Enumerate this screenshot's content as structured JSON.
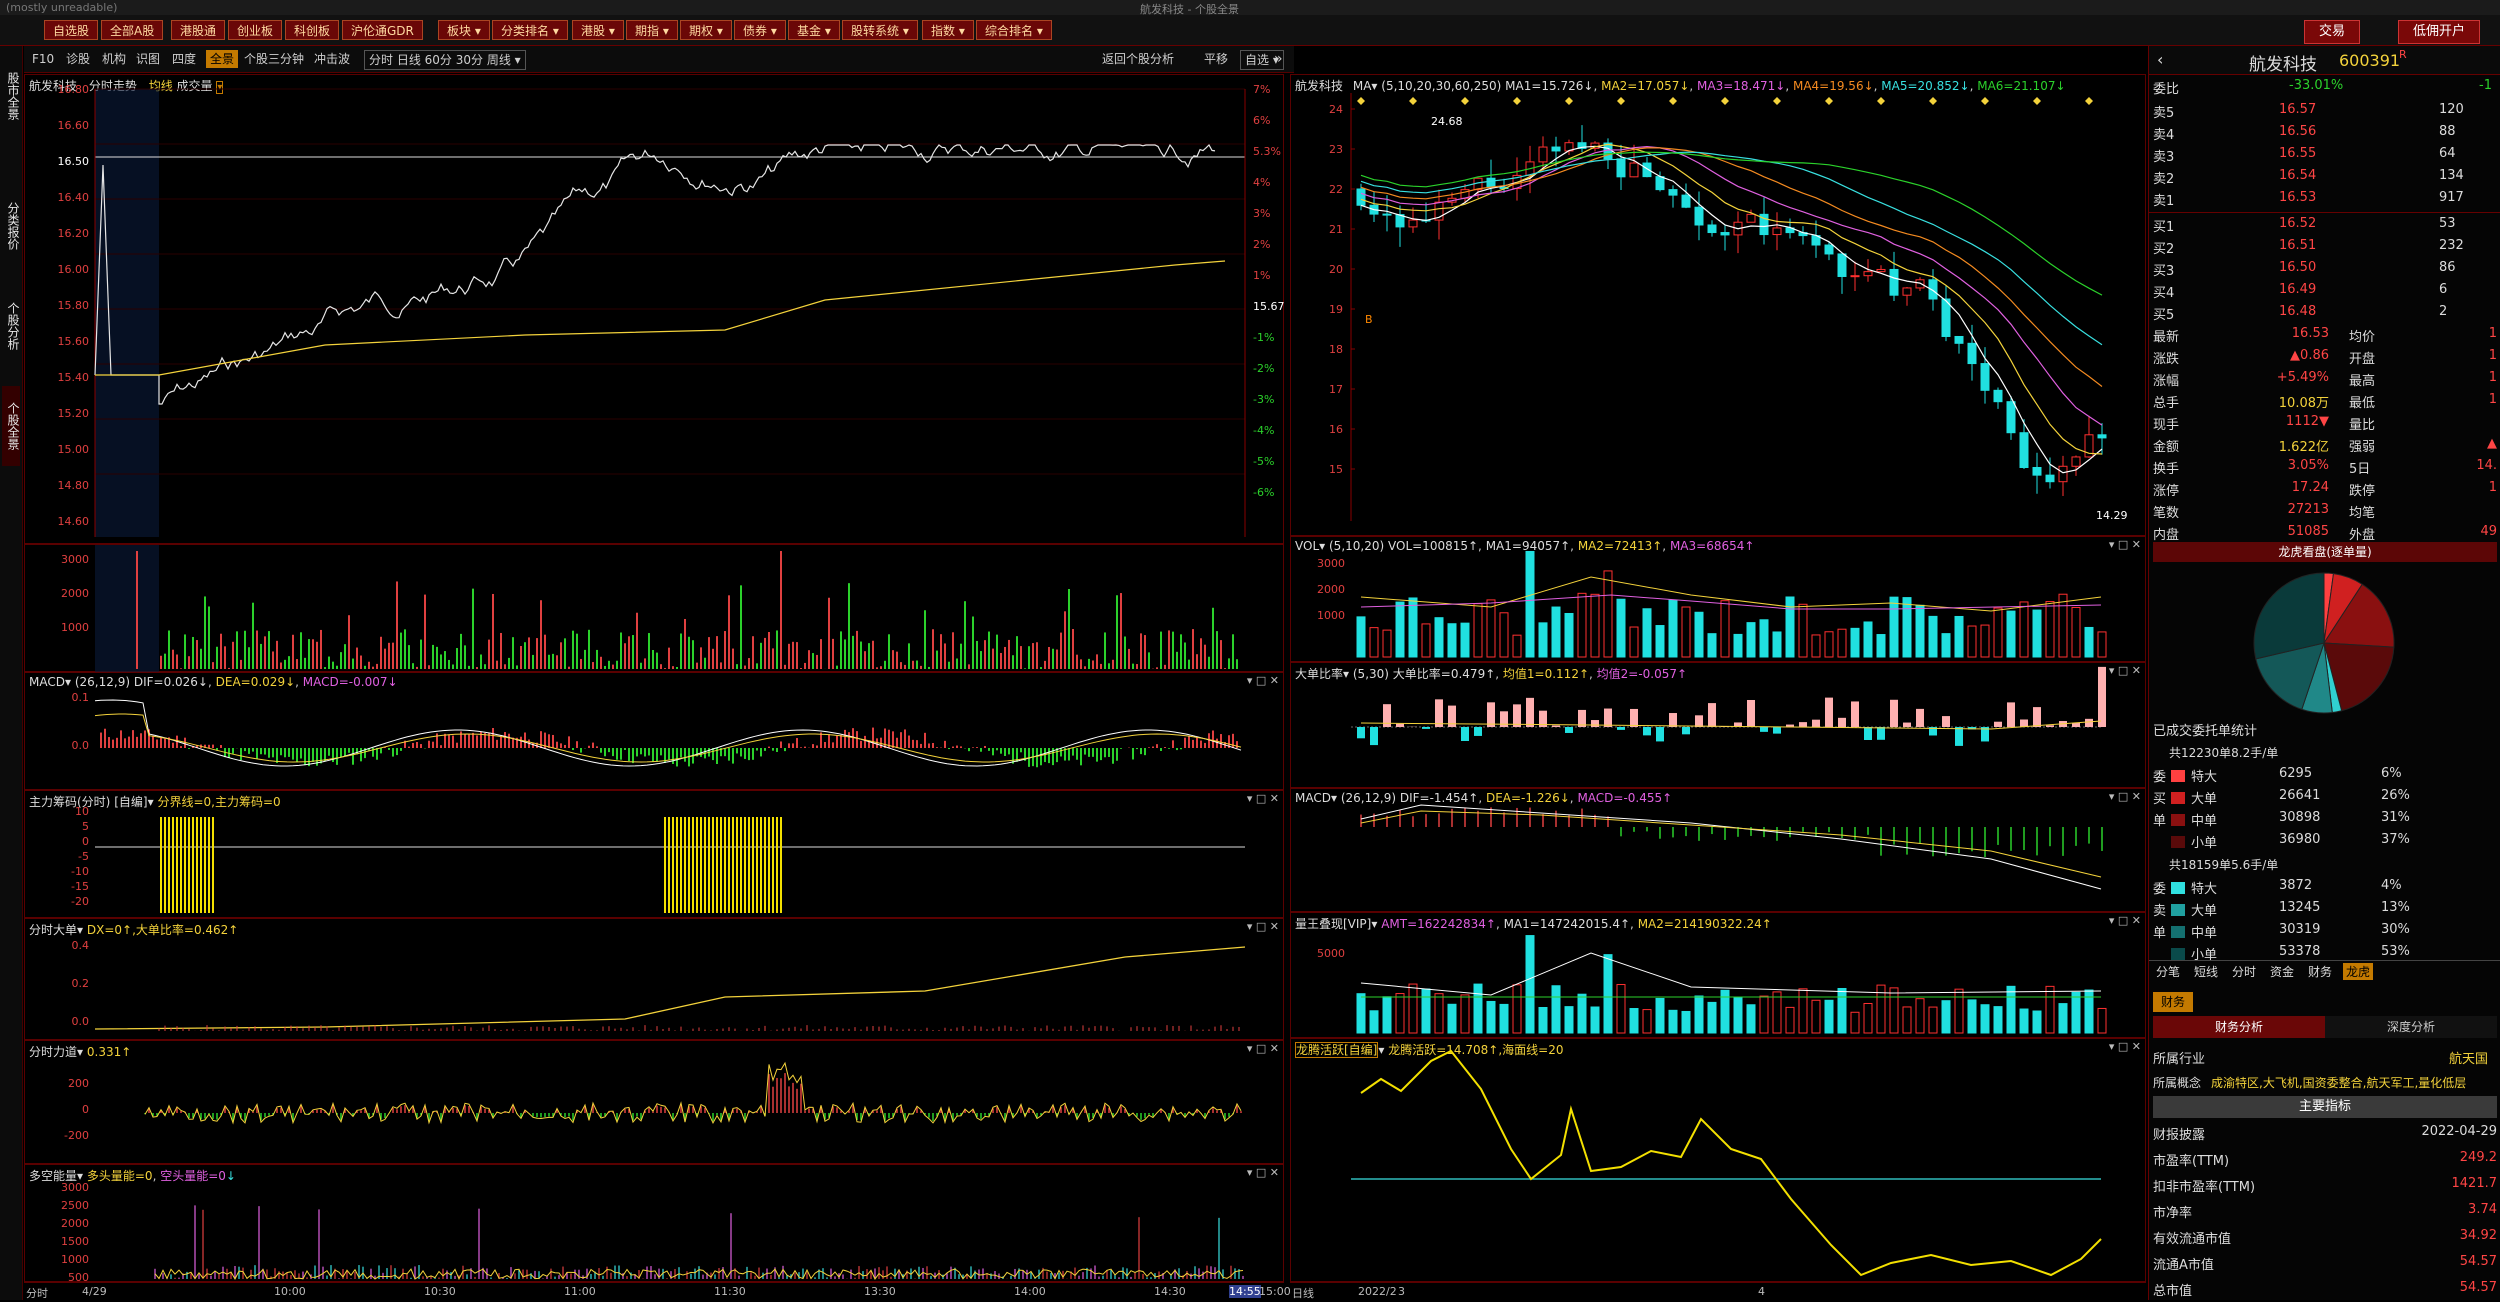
{
  "window": {
    "title": "航发科技 - 个股全景",
    "top_left": "(mostly unreadable)"
  },
  "toolbar": {
    "items": [
      "自选股",
      "全部A股",
      "港股通",
      "创业板",
      "科创板",
      "沪伦通GDR",
      "板块",
      "分类排名",
      "港股",
      "期指",
      "期权",
      "债券",
      "基金",
      "股转系统",
      "指数",
      "综合排名"
    ],
    "right_buttons": [
      "交易",
      "低佣开户"
    ]
  },
  "leftstrip": {
    "tabs": [
      "股市全景",
      "分类报价",
      "个股分析",
      "个股全景"
    ]
  },
  "subbar": {
    "items": [
      "F10",
      "诊股",
      "机构",
      "识图",
      "四度",
      "全景",
      "个股三分钟",
      "冲击波"
    ],
    "selected": "全景",
    "periods": [
      "分时",
      "日线",
      "60分",
      "30分",
      "周线"
    ],
    "right": [
      "返回个股分析",
      "平移",
      "自选"
    ]
  },
  "intraday": {
    "title": "航发科技",
    "mode": "分时走势",
    "sub": "均线",
    "sub2": "成交量",
    "price_ticks": [
      "16.80",
      "16.60",
      "16.50",
      "16.40",
      "16.20",
      "16.00",
      "15.80",
      "15.60",
      "15.40",
      "15.20",
      "15.00",
      "14.80",
      "14.60"
    ],
    "pct_ticks": [
      "7%",
      "6%",
      "5.3%",
      "4%",
      "3%",
      "2%",
      "1%",
      "15.67",
      "-1%",
      "-2%",
      "-3%",
      "-4%",
      "-5%",
      "-6%"
    ],
    "vol_ticks": [
      "3000",
      "2000",
      "1000"
    ],
    "time_ticks": [
      "分时",
      "4/29",
      "10:00",
      "10:30",
      "11:00",
      "11:30",
      "13:30",
      "14:00",
      "14:30",
      "14:55",
      "15:00"
    ]
  },
  "panels_left": {
    "macd": {
      "title": "MACD",
      "params": "(26,12,9)",
      "dif": "DIF=0.026↓",
      "dea": "DEA=0.029↓",
      "macd": "MACD=-0.007↓",
      "ticks": [
        "0.1",
        "0.0"
      ]
    },
    "zhuli": {
      "title": "主力筹码(分时)",
      "sub": "[自编]",
      "val": "分界线=0,主力筹码=0",
      "ticks": [
        "10",
        "5",
        "0",
        "-5",
        "-10",
        "-15",
        "-20"
      ]
    },
    "dadan": {
      "title": "分时大单",
      "val": "DX=0↑,大单比率=0.462↑",
      "ticks": [
        "0.4",
        "0.2",
        "0.0"
      ]
    },
    "lidao": {
      "title": "分时力道",
      "val": "0.331↑",
      "ticks": [
        "200",
        "0",
        "-200"
      ]
    },
    "duokong": {
      "title": "多空能量",
      "val": "多头量能=0",
      "val2": "空头量能=0",
      "ticks": [
        "3000",
        "2500",
        "2000",
        "1500",
        "1000",
        "500"
      ]
    }
  },
  "kline": {
    "title": "航发科技",
    "ma_label": "MA",
    "params": "(5,10,20,30,60,250)",
    "ma": [
      "MA1=15.726↓",
      "MA2=17.057↓",
      "MA3=18.471↓",
      "MA4=19.56↓",
      "MA5=20.852↓",
      "MA6=21.107↓"
    ],
    "high": "24.68",
    "low": "14.29",
    "price_ticks": [
      "24",
      "23",
      "22",
      "21",
      "20",
      "19",
      "18",
      "17",
      "16",
      "15"
    ],
    "date_ticks": [
      "日线",
      "2022/2",
      "3",
      "4"
    ],
    "ma_colors": [
      "#ffffff",
      "#f3d23b",
      "#e060e0",
      "#f38a20",
      "#38e0e0",
      "#2bd12b"
    ]
  },
  "panels_right": {
    "vol": {
      "title": "VOL",
      "params": "(5,10,20)",
      "val": "VOL=100815↑",
      "ma": [
        "MA1=94057↑",
        "MA2=72413↑",
        "MA3=68654↑"
      ],
      "ticks": [
        "3000",
        "2000",
        "1000"
      ]
    },
    "dadanratio": {
      "title": "大单比率",
      "params": "(5,30)",
      "val": "大单比率=0.479↑",
      "v2": "均值1=0.112↑",
      "v3": "均值2=-0.057↑"
    },
    "macd": {
      "title": "MACD",
      "params": "(26,12,9)",
      "dif": "DIF=-1.454↑",
      "dea": "DEA=-1.226↓",
      "macd": "MACD=-0.455↑"
    },
    "liangwang": {
      "title": "量王叠现[VIP]",
      "amt": "AMT=162242834↑",
      "ma1": "MA1=147242015.4↑",
      "ma2": "MA2=214190322.24↑",
      "ticks": [
        "5000"
      ]
    },
    "longteng": {
      "title": "龙腾活跃[自编]",
      "val": "龙腾活跃=14.708↑,海面线=20"
    }
  },
  "quote": {
    "name": "航发科技",
    "code": "600391",
    "suffix": "R",
    "weibi_label": "委比",
    "weibi": "-33.01%",
    "weicha": "-1",
    "sell": [
      {
        "l": "卖5",
        "p": "16.57",
        "v": "120"
      },
      {
        "l": "卖4",
        "p": "16.56",
        "v": "88"
      },
      {
        "l": "卖3",
        "p": "16.55",
        "v": "64"
      },
      {
        "l": "卖2",
        "p": "16.54",
        "v": "134"
      },
      {
        "l": "卖1",
        "p": "16.53",
        "v": "917"
      }
    ],
    "buy": [
      {
        "l": "买1",
        "p": "16.52",
        "v": "53"
      },
      {
        "l": "买2",
        "p": "16.51",
        "v": "232"
      },
      {
        "l": "买3",
        "p": "16.50",
        "v": "86"
      },
      {
        "l": "买4",
        "p": "16.49",
        "v": "6"
      },
      {
        "l": "买5",
        "p": "16.48",
        "v": "2"
      }
    ],
    "stats": [
      [
        "最新",
        "16.53",
        "均价",
        "1"
      ],
      [
        "涨跌",
        "▲0.86",
        "开盘",
        "1"
      ],
      [
        "涨幅",
        "+5.49%",
        "最高",
        "1"
      ],
      [
        "总手",
        "10.08万",
        "最低",
        "1"
      ],
      [
        "现手",
        "1112▼",
        "量比",
        ""
      ],
      [
        "金额",
        "1.622亿",
        "强弱",
        "▲"
      ],
      [
        "换手",
        "3.05%",
        "5日",
        "14."
      ],
      [
        "涨停",
        "17.24",
        "跌停",
        "1"
      ],
      [
        "笔数",
        "27213",
        "均笔",
        ""
      ],
      [
        "内盘",
        "51085",
        "外盘",
        "49"
      ]
    ],
    "lhb_title": "龙虎看盘(逐单量)",
    "lhb_sub": "已成交委托单统计",
    "buy_total": "共12230单8.2手/单",
    "buy_rows": [
      [
        "特大",
        "6295",
        "6%"
      ],
      [
        "大单",
        "26641",
        "26%"
      ],
      [
        "中单",
        "30898",
        "31%"
      ],
      [
        "小单",
        "36980",
        "37%"
      ]
    ],
    "sell_total": "共18159单5.6手/单",
    "sell_rows": [
      [
        "特大",
        "3872",
        "4%"
      ],
      [
        "大单",
        "13245",
        "13%"
      ],
      [
        "中单",
        "30319",
        "30%"
      ],
      [
        "小单",
        "53378",
        "53%"
      ]
    ],
    "tabs": [
      "分笔",
      "短线",
      "分时",
      "资金",
      "财务",
      "龙虎"
    ],
    "fin_tab": "财务",
    "fin_subtabs": [
      "财务分析",
      "深度分析"
    ],
    "industry_label": "所属行业",
    "industry": "航天国",
    "concept_label": "所属概念",
    "concept": "成渝特区,大飞机,国资委整合,航天军工,量化低层",
    "main_title": "主要指标",
    "fin": [
      [
        "财报披露",
        "2022-04-29"
      ],
      [
        "市盈率(TTM)",
        "249.2"
      ],
      [
        "扣非市盈率(TTM)",
        "1421.7"
      ],
      [
        "市净率",
        "3.74"
      ],
      [
        "有效流通市值",
        "34.92"
      ],
      [
        "流通A市值",
        "54.57"
      ],
      [
        "总市值",
        "54.57"
      ]
    ],
    "labels": {
      "wei": "委",
      "mai": "买",
      "dan": "单",
      "mai2": "卖",
      "sell_side": "卖",
      "buy_side": "买",
      "pan": "盘"
    }
  }
}
